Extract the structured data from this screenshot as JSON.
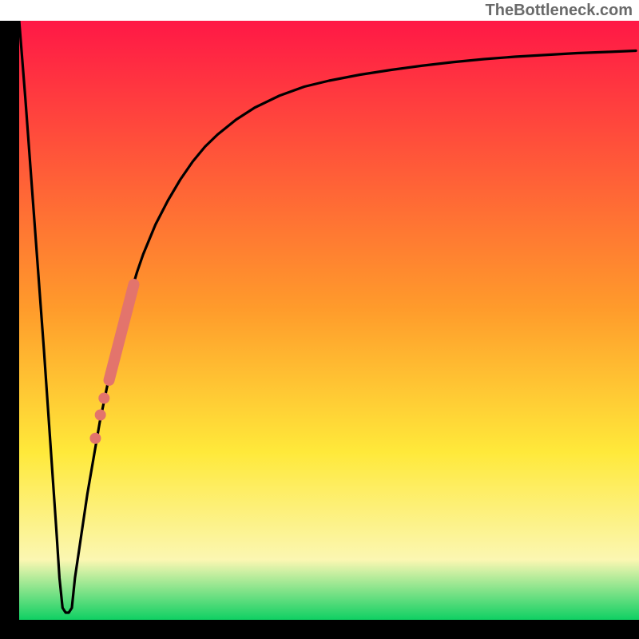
{
  "attribution": "TheBottleneck.com",
  "colors": {
    "frame": "#000000",
    "curve": "#000000",
    "marker": "#e3746c",
    "gradient_top": "#ff1846",
    "gradient_orange": "#ff9b2b",
    "gradient_yellow": "#ffe93a",
    "gradient_paleyellow": "#fbf7b2",
    "gradient_green": "#0fd063"
  },
  "chart_data": {
    "type": "line",
    "title": "",
    "xlabel": "",
    "ylabel": "",
    "xlim": [
      0,
      100
    ],
    "ylim": [
      0,
      100
    ],
    "series": [
      {
        "name": "bottleneck-curve",
        "x": [
          0,
          1,
          2,
          3,
          4,
          5,
          6,
          6.5,
          7,
          7.5,
          8,
          8.5,
          9,
          10,
          11,
          12,
          13,
          14,
          15,
          16,
          17,
          18,
          19,
          20,
          21,
          22,
          23,
          24,
          26,
          28,
          30,
          32,
          35,
          38,
          42,
          46,
          50,
          55,
          60,
          65,
          70,
          75,
          80,
          85,
          90,
          95,
          99.5
        ],
        "y": [
          100,
          87,
          73,
          59,
          45,
          30,
          15,
          7,
          2,
          1.2,
          1.2,
          2,
          7,
          14,
          21,
          27,
          33,
          38,
          43,
          47,
          51,
          54.5,
          58,
          61,
          63.5,
          66,
          68,
          70,
          73.5,
          76.5,
          79,
          81,
          83.5,
          85.5,
          87.5,
          89,
          90,
          91,
          91.8,
          92.5,
          93.1,
          93.6,
          94,
          94.3,
          94.6,
          94.8,
          95
        ]
      }
    ],
    "markers": {
      "bar_segment": {
        "x_start": 14.5,
        "y_start": 40,
        "x_end": 18.5,
        "y_end": 56
      },
      "dots": [
        {
          "x": 13.7,
          "y": 37
        },
        {
          "x": 13.1,
          "y": 34.2
        },
        {
          "x": 12.3,
          "y": 30.3
        }
      ]
    }
  }
}
